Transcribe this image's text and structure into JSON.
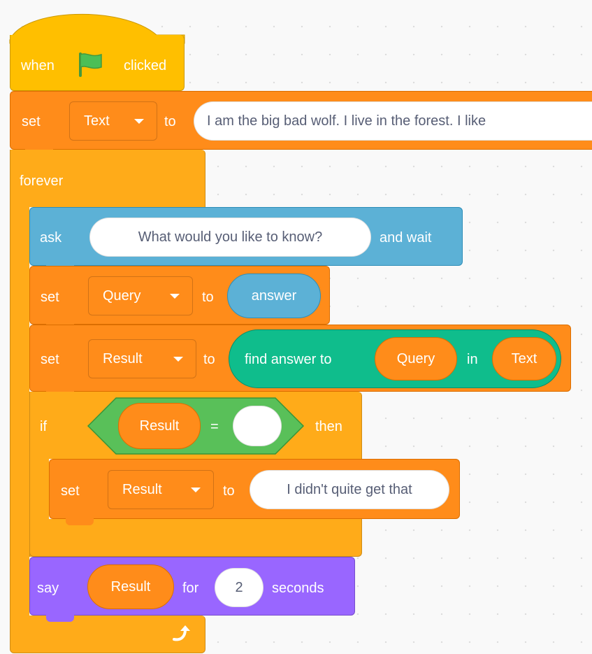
{
  "when_flag": {
    "when_label": "when",
    "clicked_label": "clicked",
    "flag_icon": "green-flag-icon"
  },
  "set_text": {
    "set_label": "set",
    "variable": "Text",
    "to_label": "to",
    "value": "I am the big bad wolf. I live in the forest. I like"
  },
  "forever": {
    "label": "forever",
    "loop_icon": "loop-arrow-icon"
  },
  "ask": {
    "ask_label": "ask",
    "question": "What would you like to know?",
    "and_wait_label": "and wait"
  },
  "set_query": {
    "set_label": "set",
    "variable": "Query",
    "to_label": "to",
    "value_reporter": "answer"
  },
  "set_result": {
    "set_label": "set",
    "variable": "Result",
    "to_label": "to",
    "find_label": "find answer to",
    "query_reporter": "Query",
    "in_label": "in",
    "text_reporter": "Text"
  },
  "if_block": {
    "if_label": "if",
    "left_reporter": "Result",
    "equals": "=",
    "right_value": "",
    "then_label": "then"
  },
  "set_fallback": {
    "set_label": "set",
    "variable": "Result",
    "to_label": "to",
    "value": "I didn't quite get that"
  },
  "say": {
    "say_label": "say",
    "reporter": "Result",
    "for_label": "for",
    "secs_value": "2",
    "seconds_label": "seconds"
  },
  "colors": {
    "events": "#ffbf00",
    "control": "#ffab19",
    "variables": "#ff8c1a",
    "sensing": "#5cb1d6",
    "looks": "#9966ff",
    "extension": "#0fbd8c",
    "flag": "#4cbf56"
  }
}
